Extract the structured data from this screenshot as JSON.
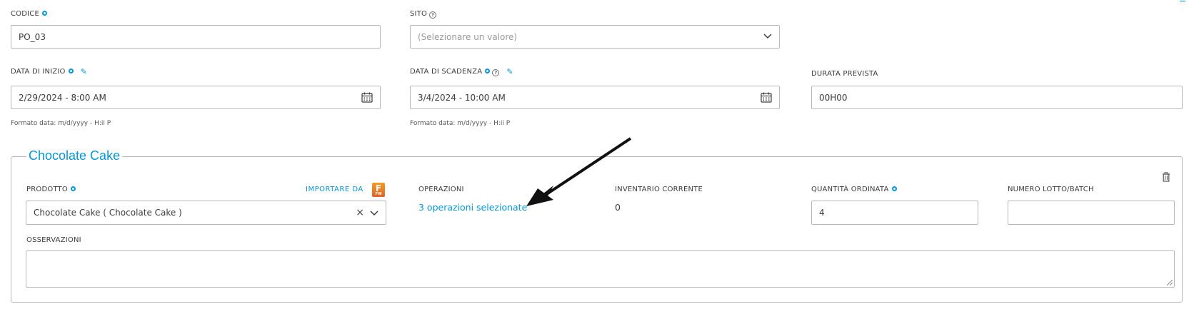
{
  "form": {
    "codice": {
      "label": "CODICE",
      "value": "PO_03"
    },
    "sito": {
      "label": "SITO",
      "placeholder": "(Selezionare un valore)"
    },
    "data_inizio": {
      "label": "DATA DI INIZIO",
      "value": "2/29/2024 - 8:00 AM",
      "hint": "Formato data: m/d/yyyy - H:ii P"
    },
    "data_scadenza": {
      "label": "DATA DI SCADENZA",
      "value": "3/4/2024 - 10:00 AM",
      "hint": "Formato data: m/d/yyyy - H:ii P"
    },
    "durata_prevista": {
      "label": "DURATA PREVISTA",
      "value": "00H00"
    }
  },
  "product_section": {
    "title": "Chocolate Cake",
    "prodotto": {
      "label": "PRODOTTO",
      "value": "Chocolate Cake ( Chocolate Cake )",
      "clear_glyph": "×"
    },
    "import": {
      "label": "IMPORTARE DA",
      "badge_letter": "F",
      "badge_sub": "FW"
    },
    "operazioni": {
      "label": "OPERAZIONI",
      "link": "3 operazioni selezionate"
    },
    "inventario": {
      "label": "INVENTARIO CORRENTE",
      "value": "0"
    },
    "quantita": {
      "label": "QUANTITÀ ORDINATA",
      "value": "4"
    },
    "lotto": {
      "label": "NUMERO LOTTO/BATCH",
      "value": ""
    },
    "osservazioni": {
      "label": "OSSERVAZIONI",
      "value": ""
    }
  },
  "icons": {
    "required": "required-dot-icon",
    "help": "help-circle-icon",
    "wand": "magic-wand-icon",
    "calendar": "calendar-icon",
    "chevron": "chevron-down-icon",
    "trash": "trash-icon",
    "arrow": "annotation-arrow"
  },
  "colors": {
    "accent": "#0696d7",
    "border": "#b8b8b8",
    "text": "#3c3c3c",
    "badge": "#f07f26"
  }
}
